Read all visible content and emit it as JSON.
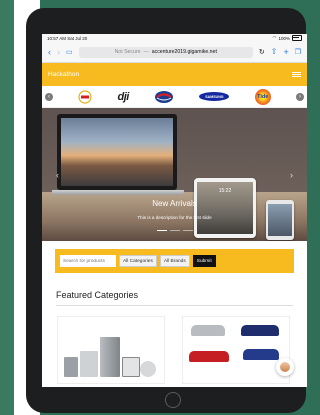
{
  "status_bar": {
    "time": "10:57 AM  Sat Jul 20",
    "battery": "100%"
  },
  "browser": {
    "security": "Not Secure",
    "sep": "—",
    "host": "accenture2019.gigamike.net"
  },
  "header": {
    "brand": "Hackathon"
  },
  "brands": {
    "items": [
      "coca-cola",
      "dji",
      "pepsi",
      "samsung",
      "tide"
    ],
    "labels": {
      "dji": "dji",
      "samsung": "SAMSUNG",
      "tide": "Tide"
    }
  },
  "hero": {
    "title": "New Arrivals",
    "description": "This is a description for the first slide",
    "tablet_time": "15:22"
  },
  "search": {
    "placeholder": "Search for products",
    "category": "All Categories",
    "brand": "All Brands",
    "submit": "Submit"
  },
  "featured": {
    "heading": "Featured Categories"
  },
  "colors": {
    "accent": "#f7bb1f",
    "link": "#2a7ae2"
  }
}
